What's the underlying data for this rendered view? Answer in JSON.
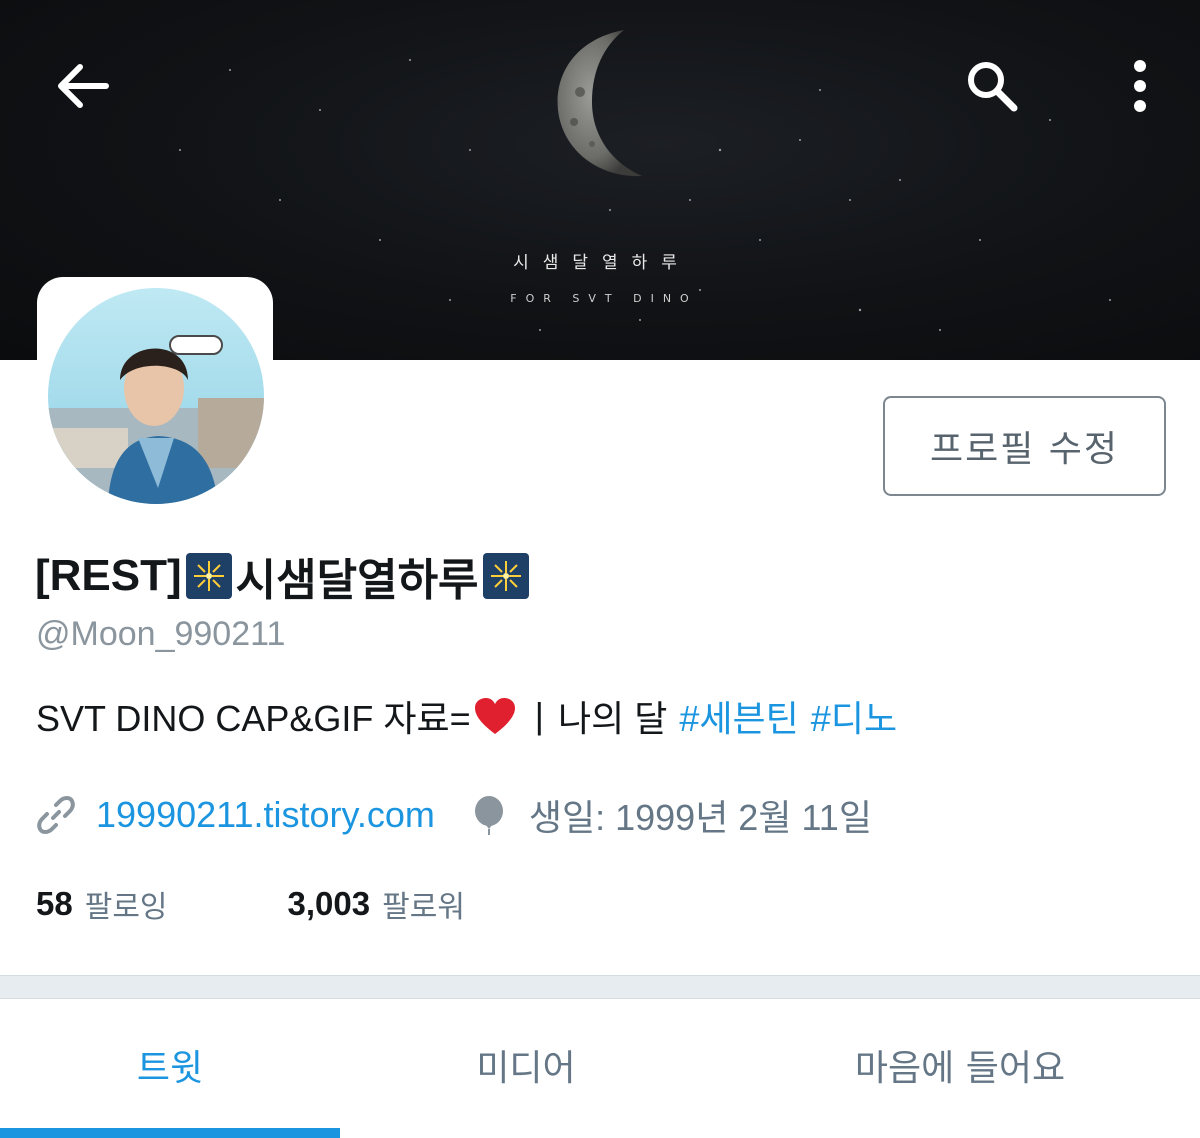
{
  "header": {
    "banner_title": "시샘달열하루",
    "banner_subtitle": "FOR SVT DINO",
    "back_icon": "arrow-left-icon",
    "search_icon": "search-icon",
    "more_icon": "more-vertical-icon"
  },
  "profile": {
    "edit_button_label": "프로필 수정",
    "name_prefix": "[REST]",
    "name_main": "시샘달열하루",
    "handle": "@Moon_990211",
    "bio": {
      "text": "SVT DINO CAP&GIF 자료=",
      "separator": "|",
      "after": "나의 달",
      "hashtags": [
        "#세븐틴",
        "#디노"
      ]
    },
    "website": "19990211.tistory.com",
    "birthday": "생일: 1999년 2월 11일",
    "following_count": "58",
    "following_label": "팔로잉",
    "followers_count": "3,003",
    "followers_label": "팔로워"
  },
  "tabs": [
    {
      "label": "트윗",
      "active": true
    },
    {
      "label": "미디어",
      "active": false
    },
    {
      "label": "마음에 들어요",
      "active": false
    }
  ],
  "colors": {
    "accent": "#1b95e0",
    "text": "#14171a",
    "muted": "#657786"
  }
}
